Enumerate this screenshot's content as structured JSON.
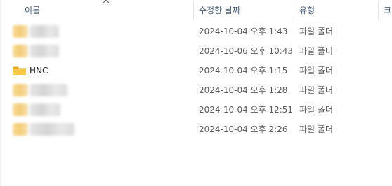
{
  "header": {
    "name_label": "이름",
    "date_label": "수정한 날짜",
    "type_label": "유형",
    "extra_label": "크"
  },
  "rows": [
    {
      "name": "",
      "date": "2024-10-04 오후 1:43",
      "type": "파일 폴더"
    },
    {
      "name": "",
      "date": "2024-10-06 오후 10:43",
      "type": "파일 폴더"
    },
    {
      "name": "HNC",
      "date": "2024-10-04 오후 1:15",
      "type": "파일 폴더"
    },
    {
      "name": "",
      "date": "2024-10-04 오후 1:28",
      "type": "파일 폴더"
    },
    {
      "name": "",
      "date": "2024-10-04 오후 12:51",
      "type": "파일 폴더"
    },
    {
      "name": "",
      "date": "2024-10-04 오후 2:26",
      "type": "파일 폴더"
    }
  ],
  "colors": {
    "folder_yellow": "#f5c542",
    "header_text": "#4c607a",
    "cell_text": "#5c5c5c"
  },
  "icons": {
    "sort": "sort-ascending-icon",
    "folder": "folder-icon"
  }
}
